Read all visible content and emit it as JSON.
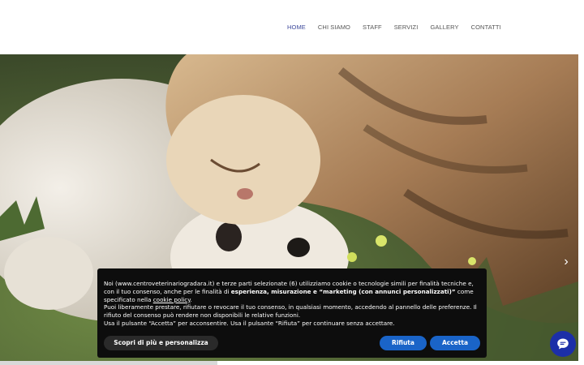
{
  "nav": {
    "items": [
      {
        "label": "HOME",
        "active": true
      },
      {
        "label": "CHI SIAMO",
        "active": false
      },
      {
        "label": "STAFF",
        "active": false
      },
      {
        "label": "SERVIZI",
        "active": false
      },
      {
        "label": "GALLERY",
        "active": false
      },
      {
        "label": "CONTATTI",
        "active": false
      }
    ],
    "active_color": "#3e4a9c"
  },
  "hero": {
    "image_description_icon": "hero-photo",
    "next_arrow": "›"
  },
  "cookie": {
    "text_1": "Noi (www.centroveterinariogradara.it) e terze parti selezionate (6) utilizziamo cookie o tecnologie simili per finalità tecniche e, con il tuo consenso, anche per le finalità di ",
    "text_bold": "esperienza, misurazione e “marketing (con annunci personalizzati)”",
    "text_2": " come specificato nella ",
    "link": "cookie policy",
    "text_3": ".",
    "line_2": "Puoi liberamente prestare, rifiutare o revocare il tuo consenso, in qualsiasi momento, accedendo al pannello delle preferenze. Il rifiuto del consenso può rendere non disponibili le relative funzioni.",
    "line_3": "Usa il pulsante “Accetta” per acconsentire. Usa il pulsante “Rifiuta” per continuare senza accettare.",
    "btn_prefs": "Scopri di più e personalizza",
    "btn_reject": "Rifiuta",
    "btn_accept": "Accetta",
    "button_color": "#1a64c8"
  },
  "chat": {
    "icon": "chat-icon",
    "color": "#1c2fa8"
  }
}
